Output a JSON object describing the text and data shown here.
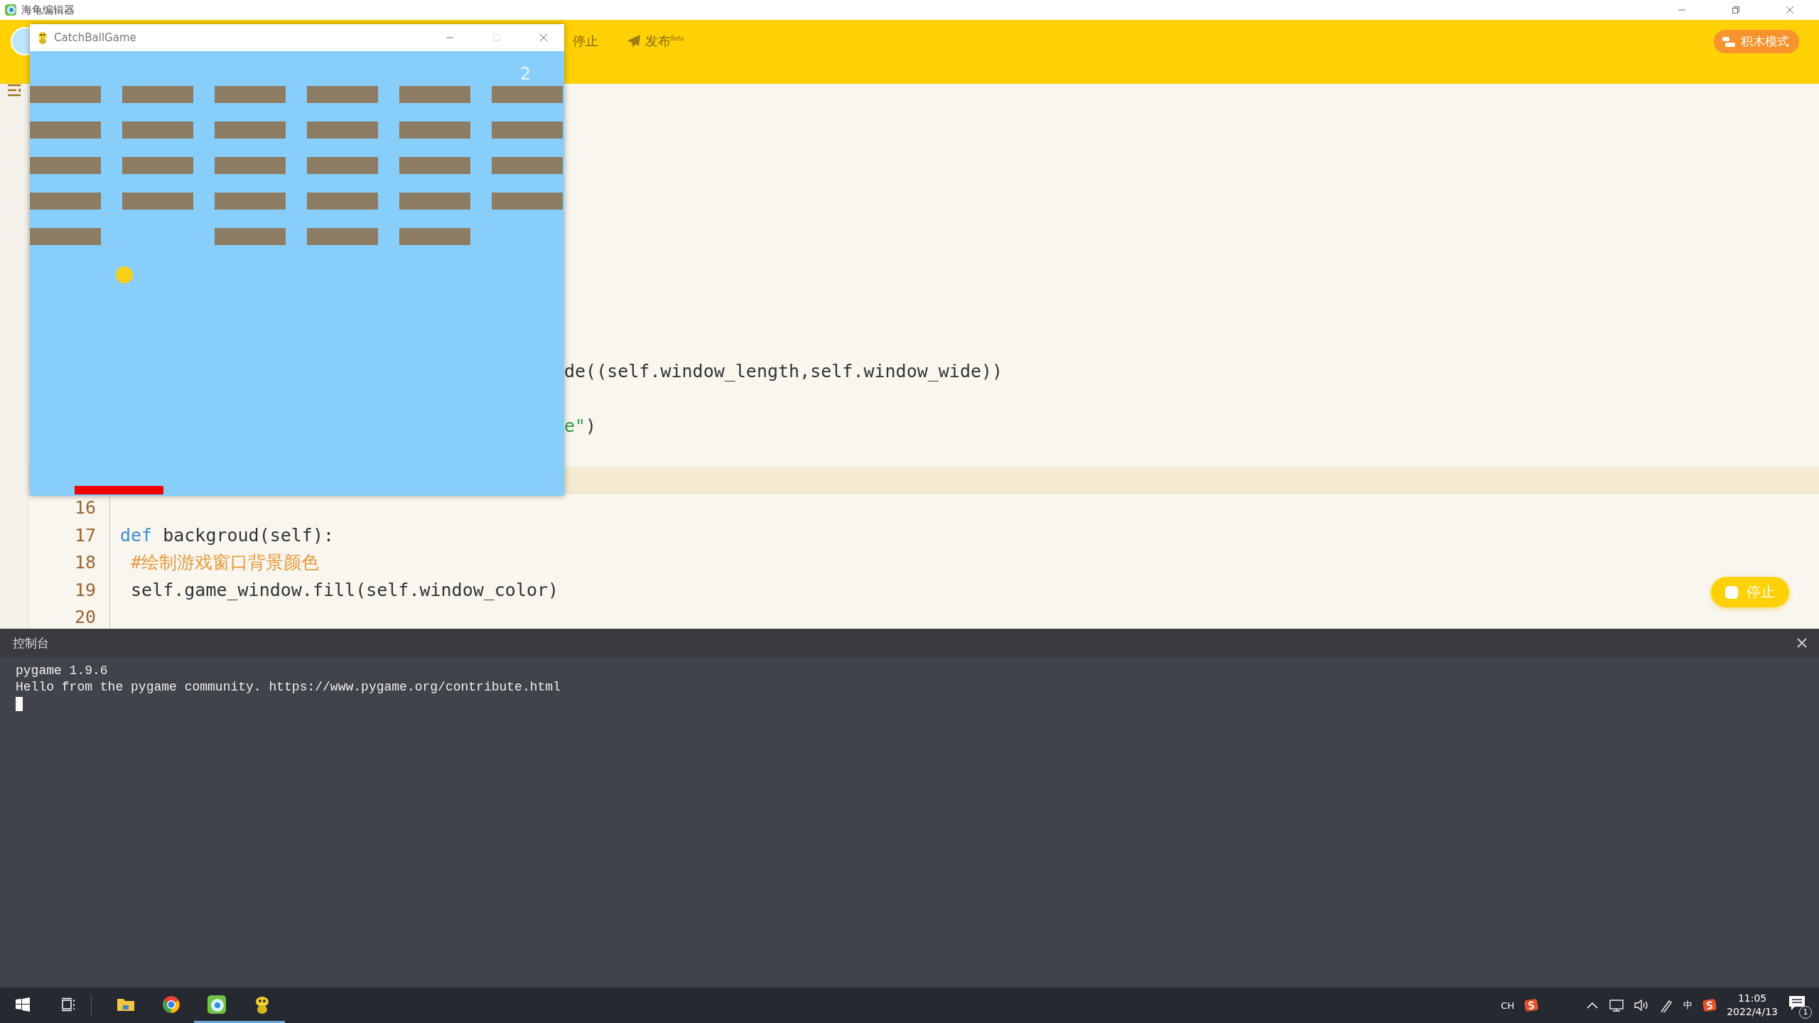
{
  "app": {
    "title": "海龟编辑器"
  },
  "toolbar": {
    "stop_label": "停止",
    "publish_label": "发布$^{Beta}$",
    "mode_button": "积木模式"
  },
  "editor": {
    "lines": [
      {
        "current": false
      },
      {
        "current": false
      },
      {
        "current": false
      },
      {
        "current": false
      },
      {
        "current": false
      },
      {
        "current": false
      },
      {
        "current": false
      },
      {
        "current": false
      },
      {
        "current": false
      },
      {
        "current": false
      },
      {
        "current": false,
        "segments": [
          {
            "kind": "plain",
            "text": "de((self.window_length,self.window_wide))"
          }
        ]
      },
      {
        "current": false
      },
      {
        "current": false,
        "segments": [
          {
            "kind": "string",
            "text": "e\""
          },
          {
            "kind": "plain",
            "text": ")"
          }
        ]
      },
      {
        "current": false
      },
      {
        "current": true
      },
      {
        "current": false,
        "number": "16"
      },
      {
        "current": false,
        "number": "17",
        "segments": [
          {
            "kind": "keyword",
            "text": "def"
          },
          {
            "kind": "plain",
            "text": " backgroud(self):"
          }
        ]
      },
      {
        "current": false,
        "number": "18",
        "segments": [
          {
            "kind": "comment",
            "text": " #绘制游戏窗口背景颜色"
          }
        ]
      },
      {
        "current": false,
        "number": "19",
        "segments": [
          {
            "kind": "plain",
            "text": " self.game_window.fill(self.window_color)"
          }
        ]
      },
      {
        "current": false,
        "number": "20"
      }
    ],
    "run_button": "停止"
  },
  "game_window": {
    "title": "CatchBallGame",
    "controls": [
      {
        "kind": "minimize",
        "disabled": false
      },
      {
        "kind": "maximize",
        "disabled": true
      },
      {
        "kind": "close",
        "disabled": false
      }
    ],
    "score": "2",
    "bricks": [
      [
        true,
        true,
        true,
        true,
        true,
        true
      ],
      [
        true,
        true,
        true,
        true,
        true,
        true
      ],
      [
        true,
        true,
        true,
        true,
        true,
        true
      ],
      [
        true,
        true,
        true,
        true,
        true,
        true
      ],
      [
        true,
        false,
        true,
        true,
        true,
        false
      ]
    ]
  },
  "console": {
    "title": "控制台",
    "lines": [
      "pygame 1.9.6",
      "Hello from the pygame community. https://www.pygame.org/contribute.html"
    ]
  },
  "taskbar": {
    "apps": [
      {
        "kind": "explorer",
        "running": false
      },
      {
        "kind": "browser",
        "running": false
      },
      {
        "kind": "editor",
        "running": true
      },
      {
        "kind": "game",
        "running": true
      }
    ],
    "tray": {
      "input_lang": "CH",
      "ime": "中",
      "time": "11:05",
      "date": "2022/4/13",
      "notifications": "1"
    }
  }
}
